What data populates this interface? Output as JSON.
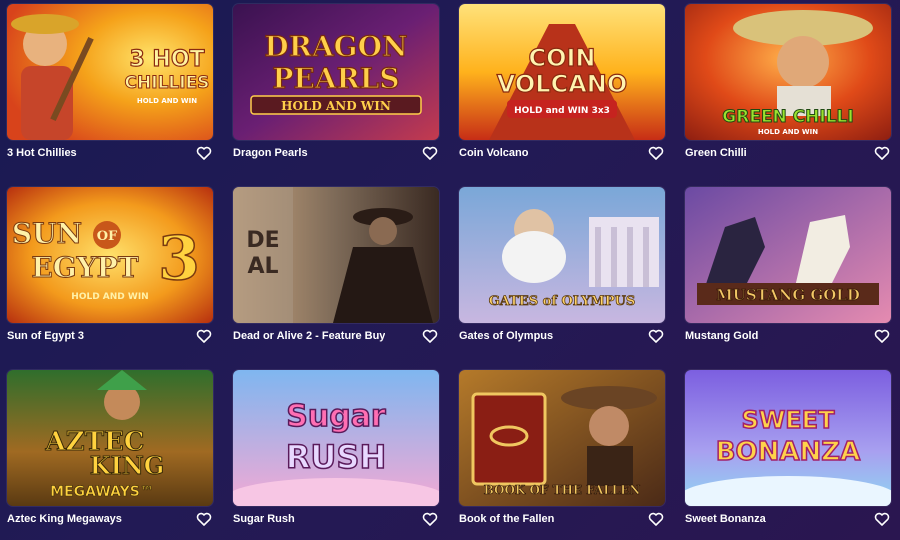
{
  "games": [
    {
      "title": "3 Hot Chillies",
      "art_text": [
        "3 HOT",
        "CHILLIES",
        "HOLD AND WIN"
      ],
      "colors": [
        "#f5a21a",
        "#d8431b",
        "#ffe36a"
      ]
    },
    {
      "title": "Dragon Pearls",
      "art_text": [
        "DRAGON",
        "PEARLS",
        "HOLD AND WIN"
      ],
      "colors": [
        "#6a1f73",
        "#c43b4e",
        "#ffcf4a"
      ]
    },
    {
      "title": "Coin Volcano",
      "art_text": [
        "COIN",
        "VOLCANO",
        "HOLD and WIN 3x3"
      ],
      "colors": [
        "#ffb21c",
        "#c72d16",
        "#ffe27a"
      ]
    },
    {
      "title": "Green Chilli",
      "art_text": [
        "GREEN CHILLI",
        "HOLD AND WIN"
      ],
      "colors": [
        "#e04a18",
        "#8a1c10",
        "#9be22f"
      ]
    },
    {
      "title": "Sun of Egypt 3",
      "art_text": [
        "SUN",
        "OF",
        "EGYPT",
        "3",
        "HOLD AND WIN"
      ],
      "colors": [
        "#f39a1c",
        "#b8310f",
        "#ffe06a"
      ]
    },
    {
      "title": "Dead or Alive 2 - Feature Buy",
      "art_text": [
        "DE",
        "AL"
      ],
      "colors": [
        "#7d6a58",
        "#3a2a22",
        "#c9a57f"
      ]
    },
    {
      "title": "Gates of Olympus",
      "art_text": [
        "GATES of OLYMPUS"
      ],
      "colors": [
        "#7aa7d8",
        "#c8b7e0",
        "#ffd46a"
      ]
    },
    {
      "title": "Mustang Gold",
      "art_text": [
        "MUSTANG GOLD"
      ],
      "colors": [
        "#6b4aa3",
        "#e58bb0",
        "#f2c766"
      ]
    },
    {
      "title": "Aztec King Megaways",
      "art_text": [
        "AZTEC",
        "KING",
        "MEGAWAYS™"
      ],
      "colors": [
        "#2f6e2c",
        "#a06a22",
        "#ffd23f"
      ]
    },
    {
      "title": "Sugar Rush",
      "art_text": [
        "Sugar",
        "RUSH"
      ],
      "colors": [
        "#7fb6f0",
        "#f3a9d4",
        "#ff6fb3"
      ]
    },
    {
      "title": "Book of the Fallen",
      "art_text": [
        "BOOK OF THE FALLEN"
      ],
      "colors": [
        "#b57a2a",
        "#4b2a17",
        "#f0c760"
      ]
    },
    {
      "title": "Sweet Bonanza",
      "art_text": [
        "SWEET",
        "BONANZA"
      ],
      "colors": [
        "#7c5fe0",
        "#8fd6f2",
        "#ffd24a"
      ]
    }
  ],
  "icons": {
    "favorite": "heart-outline-icon"
  }
}
